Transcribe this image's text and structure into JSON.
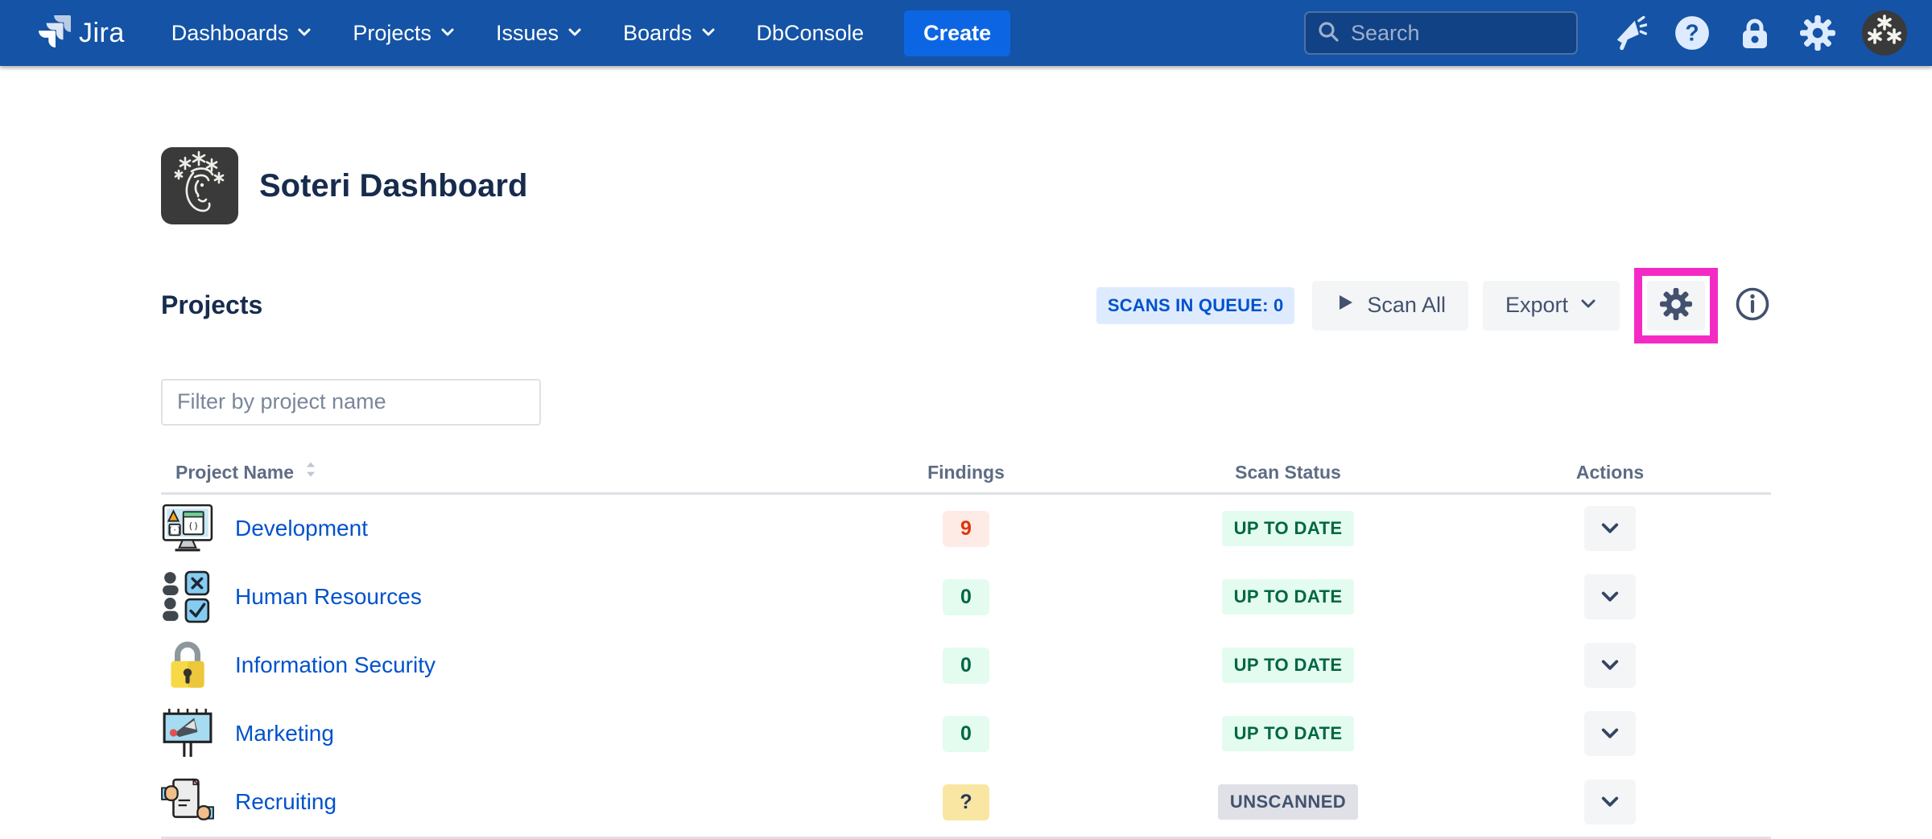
{
  "nav": {
    "brand": "Jira",
    "items": [
      {
        "label": "Dashboards",
        "has_chevron": true
      },
      {
        "label": "Projects",
        "has_chevron": true
      },
      {
        "label": "Issues",
        "has_chevron": true
      },
      {
        "label": "Boards",
        "has_chevron": true
      },
      {
        "label": "DbConsole",
        "has_chevron": false
      }
    ],
    "create_label": "Create",
    "search_placeholder": "Search",
    "icons": [
      "search-icon",
      "announcement-icon",
      "help-icon",
      "lock-icon",
      "gear-icon",
      "soteri-avatar"
    ]
  },
  "page": {
    "title": "Soteri Dashboard",
    "app_icon": "soteri-face-stars-icon",
    "section_title": "Projects",
    "queue_badge": "SCANS IN QUEUE: 0",
    "scan_all_label": "Scan All",
    "export_label": "Export",
    "toolbar_icons": [
      "play-icon",
      "chevron-down-icon",
      "gear-icon",
      "info-icon"
    ],
    "gear_highlighted": true,
    "filter_placeholder": "Filter by project name"
  },
  "table": {
    "columns": [
      "Project Name",
      "Findings",
      "Scan Status",
      "Actions"
    ],
    "sortable_column": "Project Name",
    "rows": [
      {
        "name": "Development",
        "icon": "dev-monitor-icon",
        "findings": "9",
        "findings_type": "danger",
        "status": "UP TO DATE",
        "status_type": "success"
      },
      {
        "name": "Human Resources",
        "icon": "people-checklist-icon",
        "findings": "0",
        "findings_type": "success",
        "status": "UP TO DATE",
        "status_type": "success"
      },
      {
        "name": "Information Security",
        "icon": "padlock-icon",
        "findings": "0",
        "findings_type": "success",
        "status": "UP TO DATE",
        "status_type": "success"
      },
      {
        "name": "Marketing",
        "icon": "billboard-megaphone-icon",
        "findings": "0",
        "findings_type": "success",
        "status": "UP TO DATE",
        "status_type": "success"
      },
      {
        "name": "Recruiting",
        "icon": "document-hands-icon",
        "findings": "?",
        "findings_type": "warning",
        "status": "UNSCANNED",
        "status_type": "neutral"
      }
    ]
  },
  "colors": {
    "nav_bg": "#1453A6",
    "create_bg": "#0C66E4",
    "link": "#0052CC",
    "badge_queue_bg": "#DEEBFF",
    "badge_queue_text": "#0052CC",
    "success_bg": "#E3FCEF",
    "success_text": "#006644",
    "danger_bg": "#FFEBE6",
    "danger_text": "#DE350B",
    "warning_bg": "#FAE6A3",
    "warning_text": "#253858",
    "neutral_bg": "#DFE1E6",
    "neutral_text": "#42526E",
    "highlight": "#F32BC4"
  }
}
